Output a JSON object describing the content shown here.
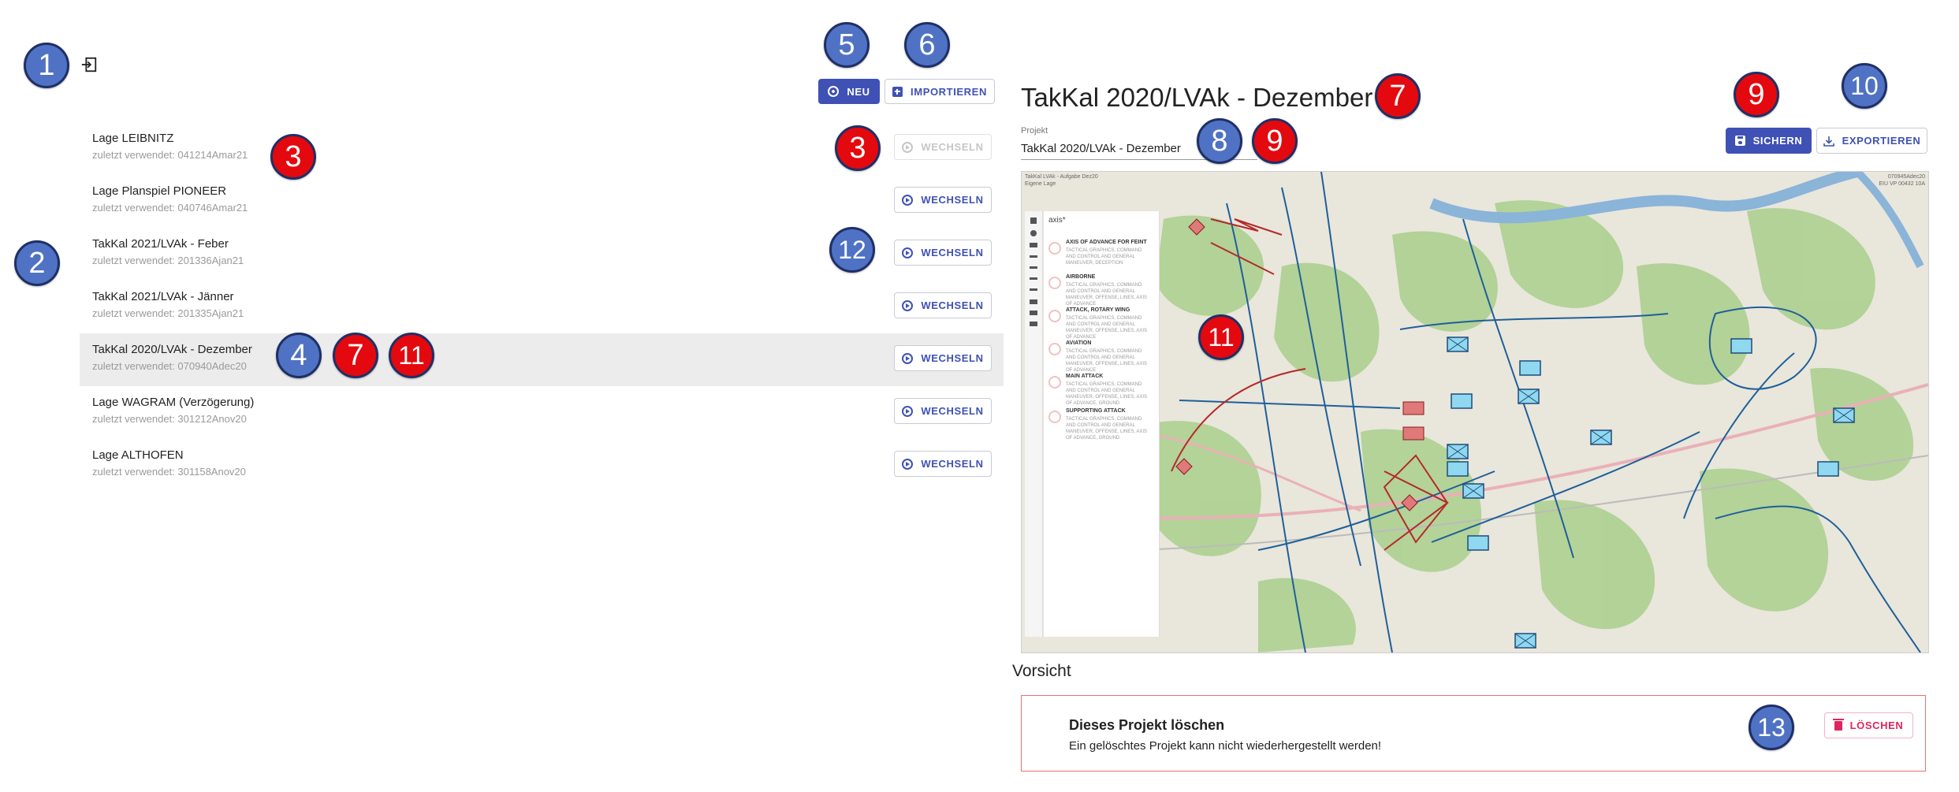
{
  "header": {
    "logout_icon": "logout-icon",
    "new_label": "NEU",
    "import_label": "IMPORTIEREN"
  },
  "projects": [
    {
      "title": "Lage LEIBNITZ",
      "subtitle": "zuletzt verwendet: 041214Amar21",
      "button": "WECHSELN",
      "disabled": true,
      "selected": false
    },
    {
      "title": "Lage Planspiel PIONEER",
      "subtitle": "zuletzt verwendet: 040746Amar21",
      "button": "WECHSELN",
      "disabled": false,
      "selected": false
    },
    {
      "title": "TakKal 2021/LVAk - Feber",
      "subtitle": "zuletzt verwendet: 201336Ajan21",
      "button": "WECHSELN",
      "disabled": false,
      "selected": false
    },
    {
      "title": "TakKal 2021/LVAk - Jänner",
      "subtitle": "zuletzt verwendet: 201335Ajan21",
      "button": "WECHSELN",
      "disabled": false,
      "selected": false
    },
    {
      "title": "TakKal 2020/LVAk - Dezember",
      "subtitle": "zuletzt verwendet: 070940Adec20",
      "button": "WECHSELN",
      "disabled": false,
      "selected": true
    },
    {
      "title": "Lage WAGRAM (Verzögerung)",
      "subtitle": "zuletzt verwendet: 301212Anov20",
      "button": "WECHSELN",
      "disabled": false,
      "selected": false
    },
    {
      "title": "Lage ALTHOFEN",
      "subtitle": "zuletzt verwendet: 301158Anov20",
      "button": "WECHSELN",
      "disabled": false,
      "selected": false
    }
  ],
  "detail": {
    "title": "TakKal 2020/LVAk - Dezember",
    "field_label": "Projekt",
    "field_value": "TakKal 2020/LVAk - Dezember",
    "save_label": "SICHERN",
    "export_label": "EXPORTIEREN"
  },
  "map": {
    "caption_line1": "TakKal LVAk - Aufgabe Dez20",
    "caption_line2": "Eigene Lage",
    "corner_line1": "070945Adec20",
    "corner_line2": "EIU VP 00432 10A",
    "search_text": "axis*",
    "legend": [
      {
        "title": "AXIS OF ADVANCE FOR FEINT",
        "desc": "TACTICAL GRAPHICS, COMMAND AND CONTROL AND GENERAL MANEUVER, DECEPTION"
      },
      {
        "title": "AIRBORNE",
        "desc": "TACTICAL GRAPHICS, COMMAND AND CONTROL AND GENERAL MANEUVER, OFFENSE, LINES, AXIS OF ADVANCE"
      },
      {
        "title": "ATTACK, ROTARY WING",
        "desc": "TACTICAL GRAPHICS, COMMAND AND CONTROL AND GENERAL MANEUVER, OFFENSE, LINES, AXIS OF ADVANCE"
      },
      {
        "title": "AVIATION",
        "desc": "TACTICAL GRAPHICS, COMMAND AND CONTROL AND GENERAL MANEUVER, OFFENSE, LINES, AXIS OF ADVANCE"
      },
      {
        "title": "MAIN ATTACK",
        "desc": "TACTICAL GRAPHICS, COMMAND AND CONTROL AND GENERAL MANEUVER, OFFENSE, LINES, AXIS OF ADVANCE, GROUND"
      },
      {
        "title": "SUPPORTING ATTACK",
        "desc": "TACTICAL GRAPHICS, COMMAND AND CONTROL AND GENERAL MANEUVER, OFFENSE, LINES, AXIS OF ADVANCE, GROUND"
      }
    ]
  },
  "danger": {
    "section_title": "Vorsicht",
    "title": "Dieses Projekt löschen",
    "text": "Ein gelöschtes Projekt kann nicht wiederhergestellt werden!",
    "delete_label": "LÖSCHEN"
  },
  "callouts": [
    {
      "label": "1",
      "color": "blue"
    },
    {
      "label": "2",
      "color": "blue"
    },
    {
      "label": "3",
      "color": "red"
    },
    {
      "label": "3",
      "color": "red"
    },
    {
      "label": "4",
      "color": "blue"
    },
    {
      "label": "5",
      "color": "blue"
    },
    {
      "label": "6",
      "color": "blue"
    },
    {
      "label": "7",
      "color": "red"
    },
    {
      "label": "7",
      "color": "red"
    },
    {
      "label": "8",
      "color": "blue"
    },
    {
      "label": "9",
      "color": "red"
    },
    {
      "label": "9",
      "color": "red"
    },
    {
      "label": "10",
      "color": "blue"
    },
    {
      "label": "11",
      "color": "red"
    },
    {
      "label": "11",
      "color": "red"
    },
    {
      "label": "12",
      "color": "blue"
    },
    {
      "label": "13",
      "color": "blue"
    }
  ],
  "colors": {
    "primary": "#3f51b5",
    "callout_blue": "#4f72c4",
    "callout_red": "#e4090f",
    "danger": "#e0245e"
  }
}
